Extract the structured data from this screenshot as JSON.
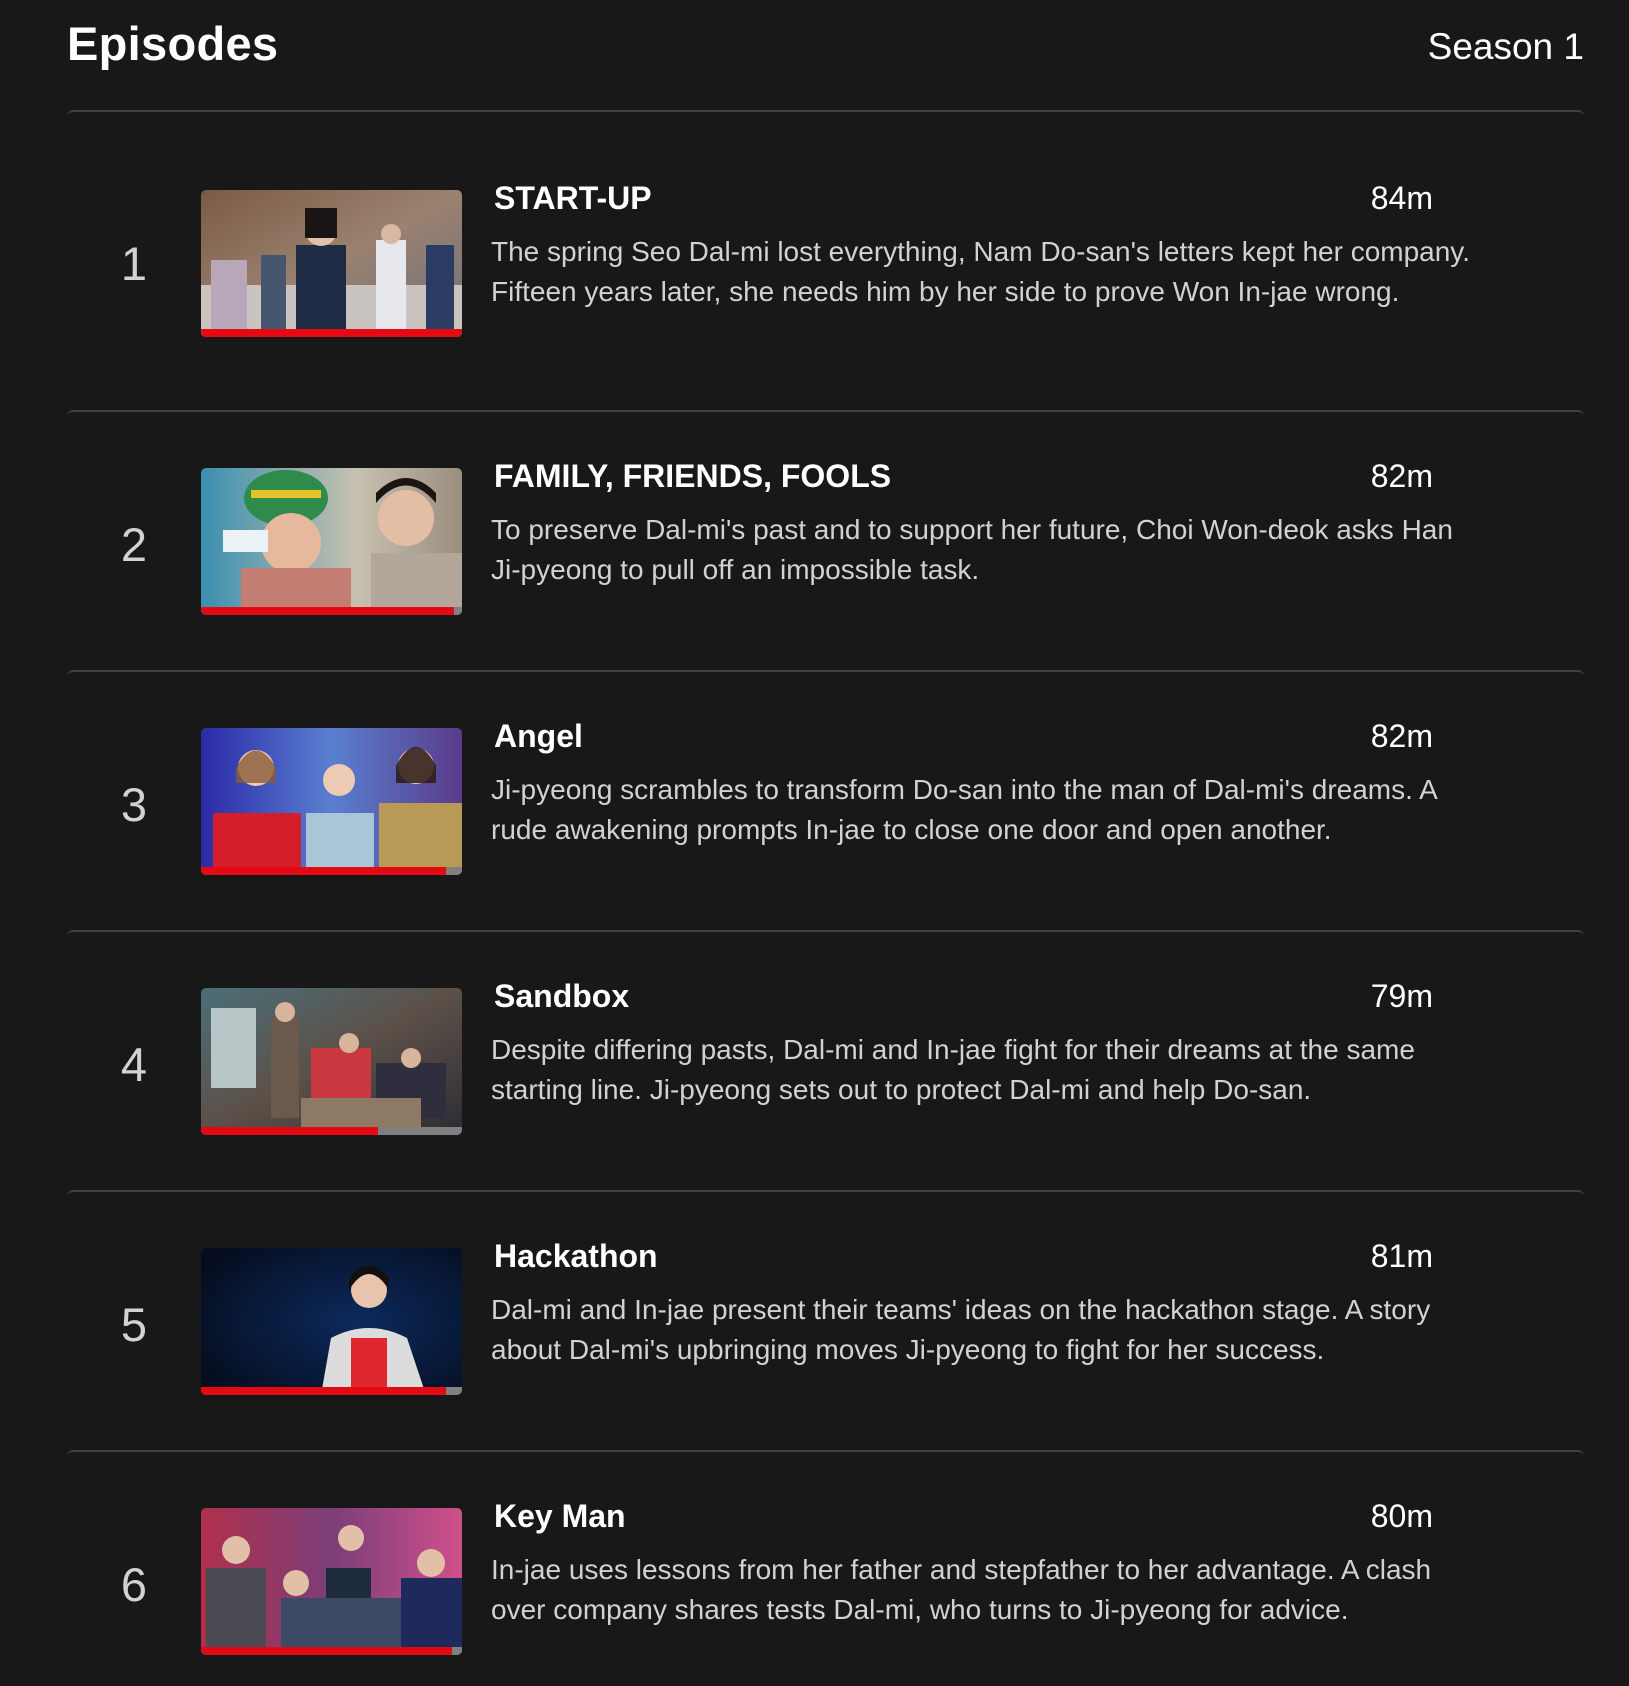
{
  "header": {
    "title": "Episodes",
    "season_label": "Season 1"
  },
  "colors": {
    "background": "#181818",
    "progress": "#e50914",
    "progress_track": "#808080",
    "divider": "#404040"
  },
  "episodes": [
    {
      "number": "1",
      "title": "START-UP",
      "runtime": "84m",
      "description": "The spring Seo Dal-mi lost everything, Nam Do-san's letters kept her company. Fifteen years later, she needs him by her side to prove Won In-jae wrong.",
      "progress": 1.0
    },
    {
      "number": "2",
      "title": "FAMILY, FRIENDS, FOOLS",
      "runtime": "82m",
      "description": "To preserve Dal-mi's past and to support her future, Choi Won-deok asks Han Ji-pyeong to pull off an impossible task.",
      "progress": 0.97
    },
    {
      "number": "3",
      "title": "Angel",
      "runtime": "82m",
      "description": "Ji-pyeong scrambles to transform Do-san into the man of Dal-mi's dreams. A rude awakening prompts In-jae to close one door and open another.",
      "progress": 0.94
    },
    {
      "number": "4",
      "title": "Sandbox",
      "runtime": "79m",
      "description": "Despite differing pasts, Dal-mi and In-jae fight for their dreams at the same starting line. Ji-pyeong sets out to protect Dal-mi and help Do-san.",
      "progress": 0.68
    },
    {
      "number": "5",
      "title": "Hackathon",
      "runtime": "81m",
      "description": "Dal-mi and In-jae present their teams' ideas on the hackathon stage. A story about Dal-mi's upbringing moves Ji-pyeong to fight for her success.",
      "progress": 0.94
    },
    {
      "number": "6",
      "title": "Key Man",
      "runtime": "80m",
      "description": "In-jae uses lessons from her father and stepfather to her advantage. A clash over company shares tests Dal-mi, who turns to Ji-pyeong for advice.",
      "progress": 0.96
    }
  ]
}
